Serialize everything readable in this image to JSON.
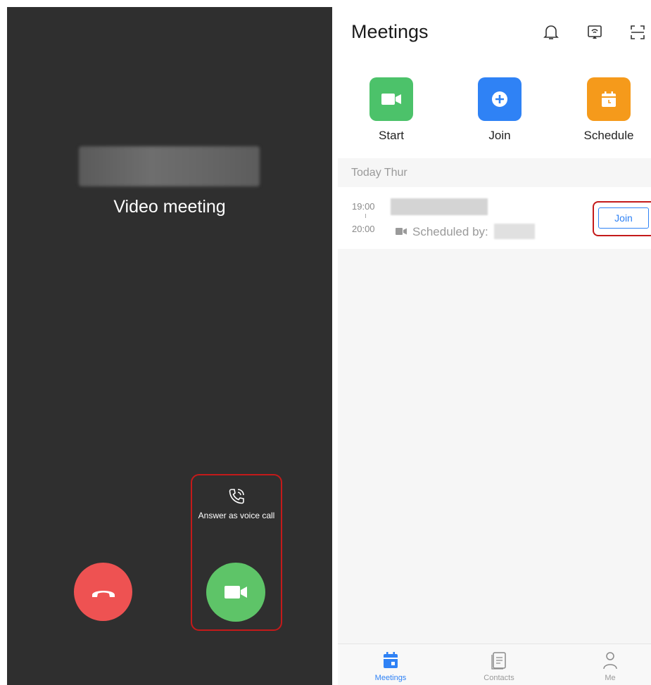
{
  "call_screen": {
    "call_type": "Video meeting",
    "voice_answer_label": "Answer as voice call",
    "icons": {
      "hangup": "phone-hangup-icon",
      "voice": "phone-voice-icon",
      "video": "video-camera-icon"
    },
    "colors": {
      "background": "#2f2f2f",
      "hangup": "#ee5252",
      "answer": "#5ec468",
      "highlight": "#c41a1a"
    }
  },
  "meetings_app": {
    "title": "Meetings",
    "header_icons": [
      "bell-icon",
      "cast-screen-icon",
      "scan-icon"
    ],
    "actions": [
      {
        "label": "Start",
        "icon": "video-camera-icon",
        "color": "#4cc26a"
      },
      {
        "label": "Join",
        "icon": "plus-circle-icon",
        "color": "#2f82f5"
      },
      {
        "label": "Schedule",
        "icon": "calendar-icon",
        "color": "#f59a1b"
      }
    ],
    "section_header": "Today Thur",
    "meeting": {
      "start_time": "19:00",
      "end_time": "20:00",
      "scheduled_by_label": "Scheduled by:",
      "join_label": "Join"
    },
    "tabs": [
      {
        "label": "Meetings",
        "icon": "calendar-icon",
        "active": true
      },
      {
        "label": "Contacts",
        "icon": "contacts-icon",
        "active": false
      },
      {
        "label": "Me",
        "icon": "person-icon",
        "active": false
      }
    ],
    "colors": {
      "accent": "#2f82f5",
      "inactive_tab": "#9a9a9a"
    }
  }
}
